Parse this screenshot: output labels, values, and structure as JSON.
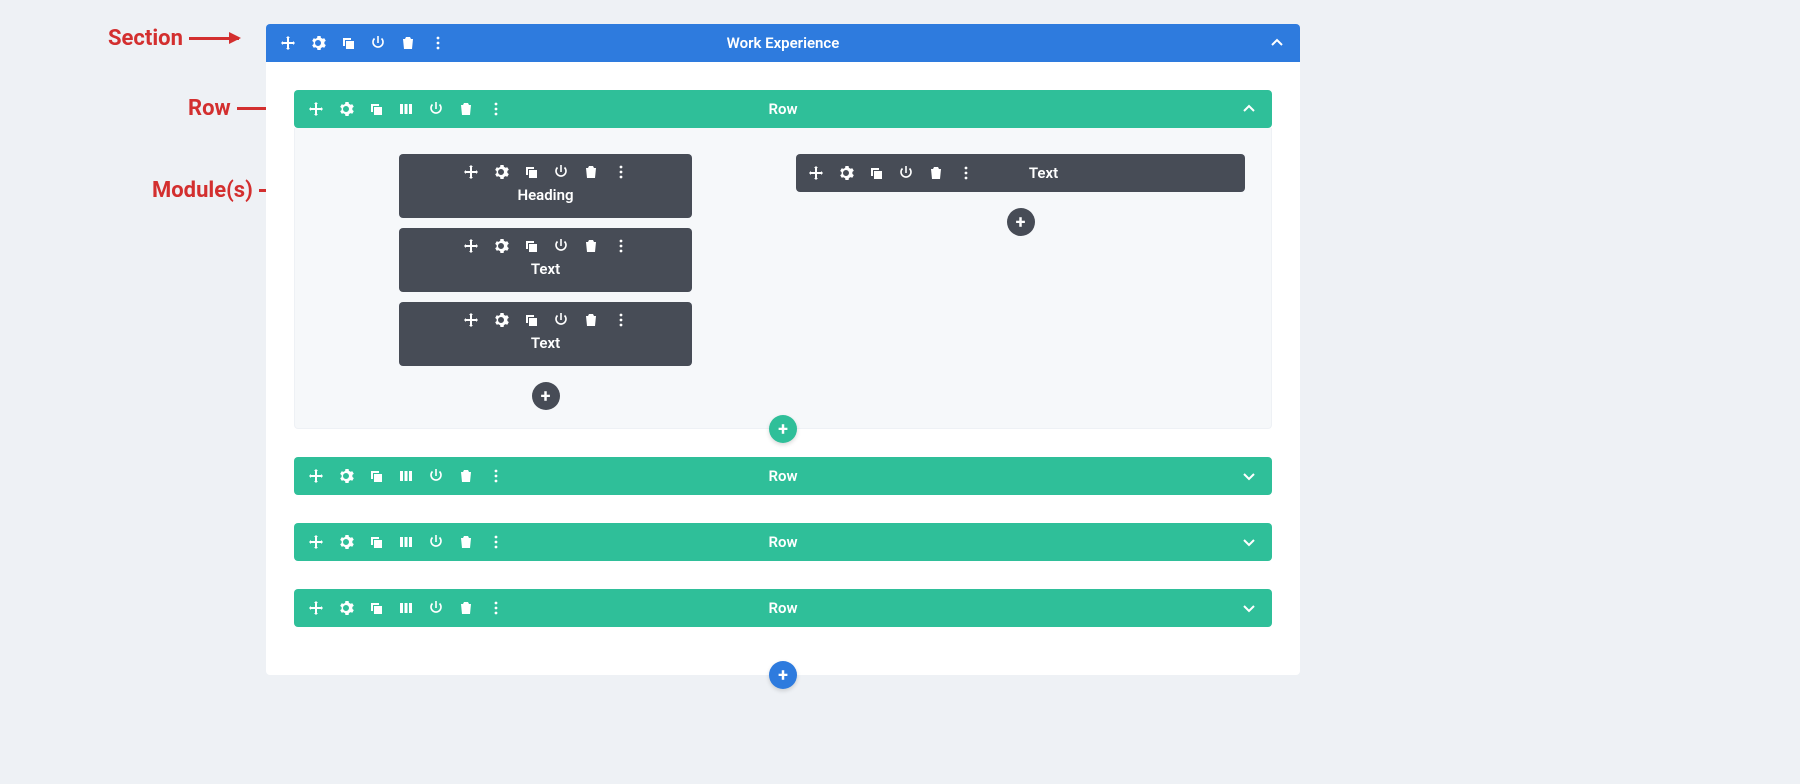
{
  "annotations": {
    "section": "Section",
    "row": "Row",
    "modules": "Module(s)"
  },
  "section": {
    "title": "Work Experience"
  },
  "rows": [
    {
      "title": "Row",
      "expanded": true
    },
    {
      "title": "Row",
      "expanded": false
    },
    {
      "title": "Row",
      "expanded": false
    },
    {
      "title": "Row",
      "expanded": false
    }
  ],
  "modules": {
    "left": [
      {
        "title": "Heading"
      },
      {
        "title": "Text"
      },
      {
        "title": "Text"
      }
    ],
    "right": [
      {
        "title": "Text"
      }
    ]
  },
  "glyphs": {
    "plus": "+"
  }
}
